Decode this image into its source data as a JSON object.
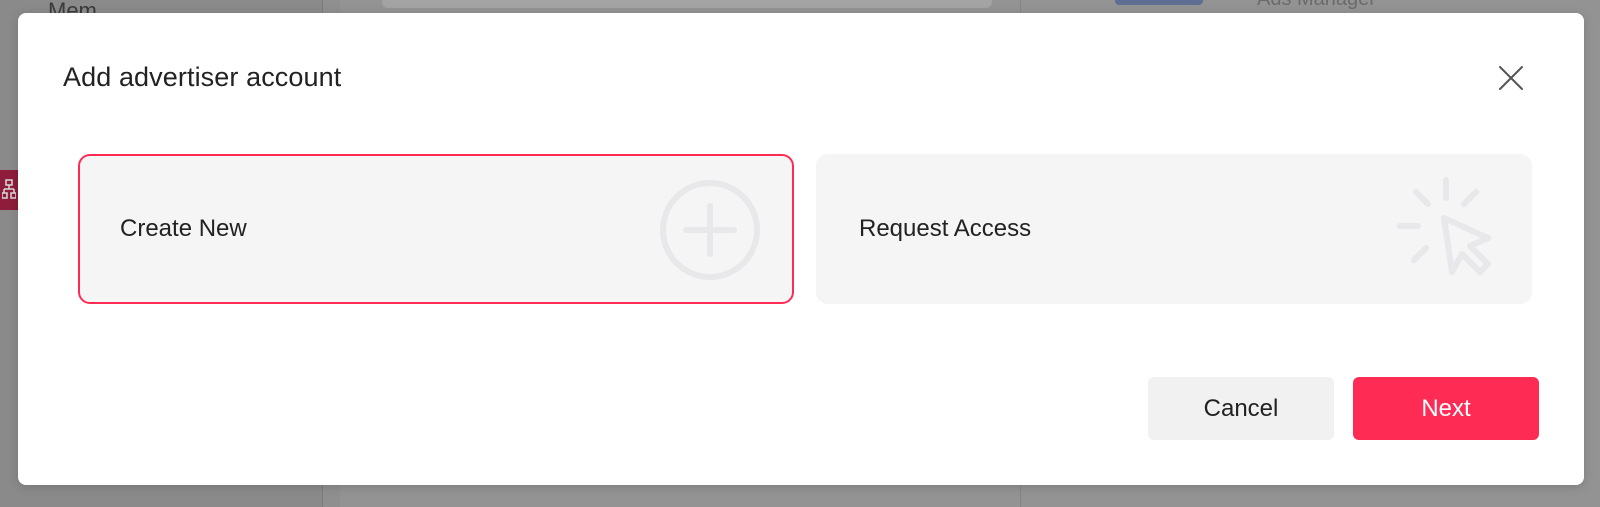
{
  "background": {
    "sidebar_label": "Mem",
    "ads_manager_label": "Ads Manager",
    "sidebar_marker_icon": "org-chart-icon",
    "sidebar_marker_color": "#8e1c3a"
  },
  "modal": {
    "title": "Add advertiser account",
    "close_icon": "close-icon",
    "options": [
      {
        "label": "Create New",
        "icon": "plus-circle-icon",
        "selected": true
      },
      {
        "label": "Request Access",
        "icon": "cursor-click-icon",
        "selected": false
      }
    ],
    "cancel_label": "Cancel",
    "next_label": "Next"
  },
  "colors": {
    "accent": "#fe2c55",
    "card_bg": "#f5f5f6",
    "cancel_bg": "#f1f1f2"
  }
}
